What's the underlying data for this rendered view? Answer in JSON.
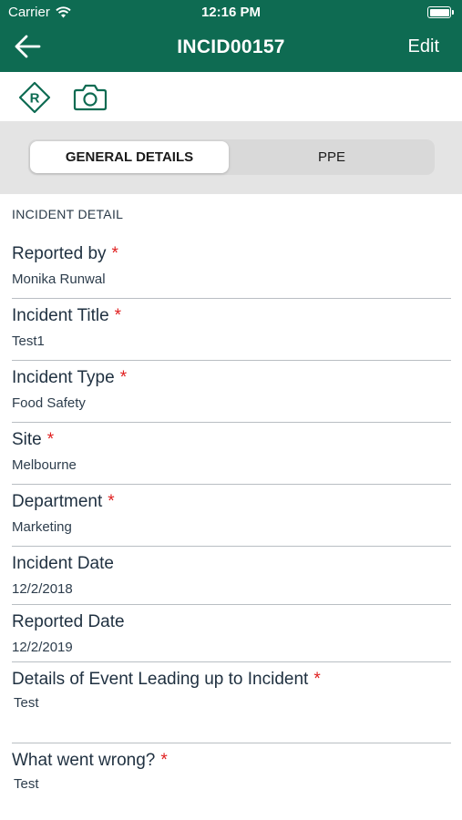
{
  "status": {
    "carrier": "Carrier",
    "time": "12:16 PM"
  },
  "nav": {
    "title": "INCID00157",
    "edit_label": "Edit"
  },
  "segments": {
    "general": "GENERAL DETAILS",
    "ppe": "PPE"
  },
  "section_heading": "INCIDENT DETAIL",
  "required_marker": "*",
  "fields": [
    {
      "label": "Reported by",
      "value": "Monika Runwal",
      "required": true
    },
    {
      "label": "Incident Title",
      "value": "Test1",
      "required": true
    },
    {
      "label": "Incident Type",
      "value": "Food Safety",
      "required": true
    },
    {
      "label": "Site",
      "value": "Melbourne",
      "required": true
    },
    {
      "label": "Department",
      "value": "Marketing",
      "required": true
    },
    {
      "label": "Incident Date",
      "value": "12/2/2018",
      "required": false
    },
    {
      "label": "Reported Date",
      "value": "12/2/2019",
      "required": false
    },
    {
      "label": "Details of Event Leading up to Incident",
      "value": "Test",
      "required": true
    },
    {
      "label": "What went wrong?",
      "value": "Test",
      "required": true
    }
  ],
  "colors": {
    "header": "#0e6b52",
    "required": "#e02020",
    "segment_bg": "#e4e4e4"
  },
  "icons": {
    "back": "arrow-left-icon",
    "report": "r-diamond-icon",
    "camera": "camera-icon",
    "wifi": "wifi-icon",
    "battery": "battery-icon"
  }
}
